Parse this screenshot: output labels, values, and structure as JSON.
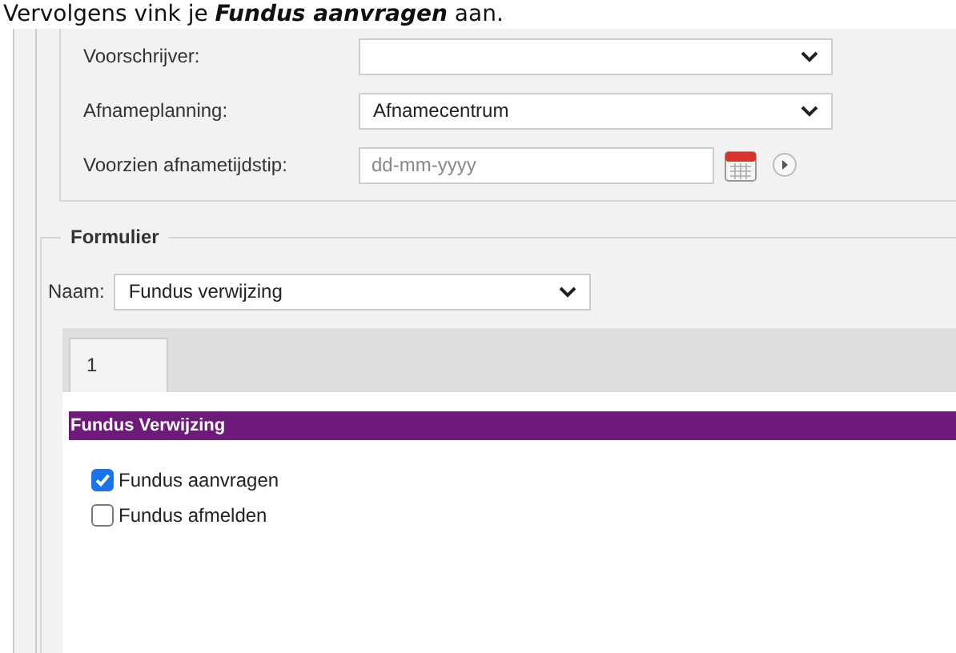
{
  "caption": "Vervolgens vink je *Fundus aanvragen* aan.",
  "fields": [
    {
      "label": "Voorschrijver:",
      "kind": "select"
    },
    {
      "label": "Afnameplanning:",
      "kind": "select",
      "value": "Afnamecentrum"
    },
    {
      "label": "Voorzien afnametijdstip:",
      "kind": "date",
      "placeholder": "dd-mm-yyyy"
    }
  ],
  "form": {
    "legend": "Formulier",
    "name_label": "Naam:",
    "name_value": "Fundus verwijzing",
    "tabs": [
      {
        "label": "1",
        "selected": true
      }
    ],
    "section_title": "Fundus Verwijzing",
    "options": [
      {
        "label": "Fundus aanvragen",
        "checked": true
      },
      {
        "label": "Fundus afmelden",
        "checked": false
      }
    ]
  }
}
